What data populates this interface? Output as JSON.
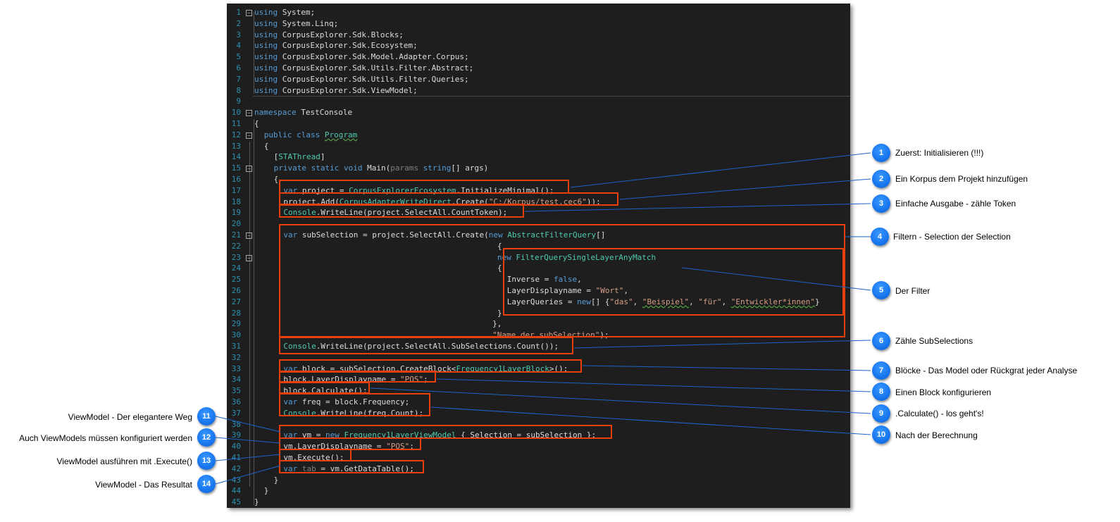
{
  "code_lines": [
    {
      "n": "1",
      "indent": 0,
      "fold": "−",
      "tokens": [
        [
          "kw",
          "using"
        ],
        [
          "plain",
          " System;"
        ]
      ]
    },
    {
      "n": "2",
      "indent": 0,
      "tokens": [
        [
          "kw",
          "using"
        ],
        [
          "plain",
          " System.Linq;"
        ]
      ]
    },
    {
      "n": "3",
      "indent": 0,
      "tokens": [
        [
          "kw",
          "using"
        ],
        [
          "plain",
          " CorpusExplorer.Sdk.Blocks;"
        ]
      ]
    },
    {
      "n": "4",
      "indent": 0,
      "tokens": [
        [
          "kw",
          "using"
        ],
        [
          "plain",
          " CorpusExplorer.Sdk.Ecosystem;"
        ]
      ]
    },
    {
      "n": "5",
      "indent": 0,
      "tokens": [
        [
          "kw",
          "using"
        ],
        [
          "plain",
          " CorpusExplorer.Sdk.Model.Adapter.Corpus;"
        ]
      ]
    },
    {
      "n": "6",
      "indent": 0,
      "tokens": [
        [
          "kw",
          "using"
        ],
        [
          "plain",
          " CorpusExplorer.Sdk.Utils.Filter.Abstract;"
        ]
      ]
    },
    {
      "n": "7",
      "indent": 0,
      "tokens": [
        [
          "kw",
          "using"
        ],
        [
          "plain",
          " CorpusExplorer.Sdk.Utils.Filter.Queries;"
        ]
      ]
    },
    {
      "n": "8",
      "indent": 0,
      "tokens": [
        [
          "kw",
          "using"
        ],
        [
          "plain",
          " CorpusExplorer.Sdk.ViewModel;"
        ]
      ]
    },
    {
      "n": "9",
      "indent": 0,
      "tokens": []
    },
    {
      "n": "10",
      "indent": 0,
      "fold": "−",
      "tokens": [
        [
          "kw",
          "namespace"
        ],
        [
          "plain",
          " TestConsole"
        ]
      ]
    },
    {
      "n": "11",
      "indent": 0,
      "tokens": [
        [
          "plain",
          "{"
        ]
      ]
    },
    {
      "n": "12",
      "indent": 2,
      "fold": "−",
      "tokens": [
        [
          "kw",
          "public"
        ],
        [
          "plain",
          " "
        ],
        [
          "kw",
          "class"
        ],
        [
          "plain",
          " "
        ],
        [
          "squig",
          "Program"
        ]
      ]
    },
    {
      "n": "13",
      "indent": 2,
      "tokens": [
        [
          "plain",
          "{"
        ]
      ]
    },
    {
      "n": "14",
      "indent": 4,
      "tokens": [
        [
          "plain",
          "["
        ],
        [
          "type",
          "STAThread"
        ],
        [
          "plain",
          "]"
        ]
      ]
    },
    {
      "n": "15",
      "indent": 4,
      "fold": "−",
      "tokens": [
        [
          "kw",
          "private"
        ],
        [
          "plain",
          " "
        ],
        [
          "kw",
          "static"
        ],
        [
          "plain",
          " "
        ],
        [
          "kw",
          "void"
        ],
        [
          "plain",
          " Main("
        ],
        [
          "param",
          "params"
        ],
        [
          "plain",
          " "
        ],
        [
          "kw",
          "string"
        ],
        [
          "plain",
          "[] args)"
        ]
      ]
    },
    {
      "n": "16",
      "indent": 4,
      "tokens": [
        [
          "plain",
          "{"
        ]
      ]
    },
    {
      "n": "17",
      "indent": 6,
      "tokens": [
        [
          "kw",
          "var"
        ],
        [
          "plain",
          " project = "
        ],
        [
          "type",
          "CorpusExplorerEcosystem"
        ],
        [
          "plain",
          ".InitializeMinimal();"
        ]
      ]
    },
    {
      "n": "18",
      "indent": 6,
      "tokens": [
        [
          "plain",
          "project.Add("
        ],
        [
          "type",
          "CorpusAdapterWriteDirect"
        ],
        [
          "plain",
          ".Create("
        ],
        [
          "str",
          "\"C:/Korpus/test.cec6\""
        ],
        [
          "plain",
          "));"
        ]
      ]
    },
    {
      "n": "19",
      "indent": 6,
      "tokens": [
        [
          "type",
          "Console"
        ],
        [
          "plain",
          ".WriteLine(project.SelectAll.CountToken);"
        ]
      ]
    },
    {
      "n": "20",
      "indent": 0,
      "tokens": []
    },
    {
      "n": "21",
      "indent": 6,
      "fold": "−",
      "tokens": [
        [
          "kw",
          "var"
        ],
        [
          "plain",
          " subSelection = project.SelectAll.Create("
        ],
        [
          "kw",
          "new"
        ],
        [
          "plain",
          " "
        ],
        [
          "type",
          "AbstractFilterQuery"
        ],
        [
          "plain",
          "[]"
        ]
      ]
    },
    {
      "n": "22",
      "indent": 50,
      "tokens": [
        [
          "plain",
          "{"
        ]
      ]
    },
    {
      "n": "23",
      "indent": 50,
      "fold": "−",
      "tokens": [
        [
          "kw",
          "new"
        ],
        [
          "plain",
          " "
        ],
        [
          "type",
          "FilterQuerySingleLayerAnyMatch"
        ]
      ]
    },
    {
      "n": "24",
      "indent": 50,
      "tokens": [
        [
          "plain",
          "{"
        ]
      ]
    },
    {
      "n": "25",
      "indent": 52,
      "tokens": [
        [
          "plain",
          "Inverse = "
        ],
        [
          "kw",
          "false"
        ],
        [
          "plain",
          ","
        ]
      ]
    },
    {
      "n": "26",
      "indent": 52,
      "tokens": [
        [
          "plain",
          "LayerDisplayname = "
        ],
        [
          "str",
          "\"Wort\""
        ],
        [
          "plain",
          ","
        ]
      ]
    },
    {
      "n": "27",
      "indent": 52,
      "tokens": [
        [
          "plain",
          "LayerQueries = "
        ],
        [
          "kw",
          "new"
        ],
        [
          "plain",
          "[] {"
        ],
        [
          "str",
          "\"das\""
        ],
        [
          "plain",
          ", "
        ],
        [
          "squigs",
          "\"Beispiel\""
        ],
        [
          "plain",
          ", "
        ],
        [
          "str",
          "\"für\""
        ],
        [
          "plain",
          ", "
        ],
        [
          "squigs",
          "\"Entwickler*innen\""
        ],
        [
          "plain",
          "}"
        ]
      ]
    },
    {
      "n": "28",
      "indent": 50,
      "tokens": [
        [
          "plain",
          "}"
        ]
      ]
    },
    {
      "n": "29",
      "indent": 49,
      "tokens": [
        [
          "plain",
          "},"
        ]
      ]
    },
    {
      "n": "30",
      "indent": 49,
      "tokens": [
        [
          "str",
          "\"Name der subSelection\""
        ],
        [
          "plain",
          ");"
        ]
      ]
    },
    {
      "n": "31",
      "indent": 6,
      "tokens": [
        [
          "type",
          "Console"
        ],
        [
          "plain",
          ".WriteLine(project.SelectAll.SubSelections.Count());"
        ]
      ]
    },
    {
      "n": "32",
      "indent": 0,
      "tokens": []
    },
    {
      "n": "33",
      "indent": 6,
      "tokens": [
        [
          "kw",
          "var"
        ],
        [
          "plain",
          " block = subSelection.CreateBlock<"
        ],
        [
          "type",
          "Frequency1LayerBlock"
        ],
        [
          "plain",
          ">();"
        ]
      ]
    },
    {
      "n": "34",
      "indent": 6,
      "tokens": [
        [
          "plain",
          "block.LayerDisplayname = "
        ],
        [
          "str",
          "\"POS\""
        ],
        [
          "plain",
          ";"
        ]
      ]
    },
    {
      "n": "35",
      "indent": 6,
      "tokens": [
        [
          "plain",
          "block.Calculate();"
        ]
      ]
    },
    {
      "n": "36",
      "indent": 6,
      "tokens": [
        [
          "kw",
          "var"
        ],
        [
          "plain",
          " freq = block.Frequency;"
        ]
      ]
    },
    {
      "n": "37",
      "indent": 6,
      "tokens": [
        [
          "type",
          "Console"
        ],
        [
          "plain",
          ".WriteLine(freq.Count);"
        ]
      ]
    },
    {
      "n": "38",
      "indent": 0,
      "tokens": []
    },
    {
      "n": "39",
      "indent": 6,
      "tokens": [
        [
          "kw",
          "var"
        ],
        [
          "plain",
          " vm = "
        ],
        [
          "kw",
          "new"
        ],
        [
          "plain",
          " "
        ],
        [
          "type",
          "Frequency1LayerViewModel"
        ],
        [
          "plain",
          " { Selection = subSelection };"
        ]
      ]
    },
    {
      "n": "40",
      "indent": 6,
      "tokens": [
        [
          "plain",
          "vm.LayerDisplayname = "
        ],
        [
          "str",
          "\"POS\""
        ],
        [
          "plain",
          ";"
        ]
      ]
    },
    {
      "n": "41",
      "indent": 6,
      "tokens": [
        [
          "plain",
          "vm.Execute();"
        ]
      ]
    },
    {
      "n": "42",
      "indent": 6,
      "tokens": [
        [
          "kw",
          "var"
        ],
        [
          "plain",
          " "
        ],
        [
          "param",
          "tab"
        ],
        [
          "plain",
          " = vm.GetDataTable();"
        ]
      ]
    },
    {
      "n": "43",
      "indent": 4,
      "tokens": [
        [
          "plain",
          "}"
        ]
      ]
    },
    {
      "n": "44",
      "indent": 2,
      "tokens": [
        [
          "plain",
          "}"
        ]
      ]
    },
    {
      "n": "45",
      "indent": 0,
      "tokens": [
        [
          "plain",
          "}"
        ]
      ]
    }
  ],
  "callouts": [
    {
      "num": "1",
      "label": "Zuerst: Initialisieren (!!!)"
    },
    {
      "num": "2",
      "label": "Ein Korpus dem Projekt hinzufügen"
    },
    {
      "num": "3",
      "label": "Einfache Ausgabe - zähle Token"
    },
    {
      "num": "4",
      "label": "Filtern - Selection der Selection"
    },
    {
      "num": "5",
      "label": "Der Filter"
    },
    {
      "num": "6",
      "label": "Zähle SubSelections"
    },
    {
      "num": "7",
      "label": "Blöcke - Das Model oder Rückgrat  jeder Analyse"
    },
    {
      "num": "8",
      "label": "Einen Block konfigurieren"
    },
    {
      "num": "9",
      "label": ".Calculate() - los geht's!"
    },
    {
      "num": "10",
      "label": "Nach der Berechnung"
    },
    {
      "num": "11",
      "label": "ViewModel - Der elegantere Weg"
    },
    {
      "num": "12",
      "label": "Auch ViewModels müssen konfiguriert werden"
    },
    {
      "num": "13",
      "label": "ViewModel ausführen mit .Execute()"
    },
    {
      "num": "14",
      "label": "ViewModel - Das Resultat"
    }
  ],
  "colors": {
    "keyword": "#569cd6",
    "type": "#4ec9b0",
    "string": "#d69d85",
    "text": "#dcdcdc",
    "line_number": "#2b91af",
    "highlight": "#e8400c",
    "badge": "#1b7ff0",
    "editor_bg": "#1e1e1e"
  }
}
